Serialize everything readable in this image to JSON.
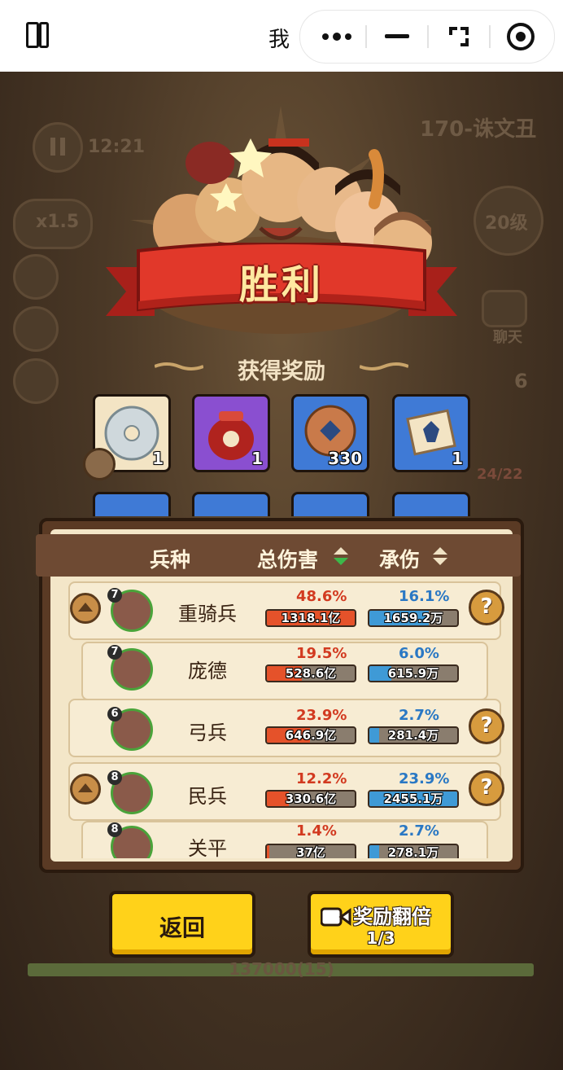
{
  "topbar": {
    "title": "我",
    "colors": {
      "bg": "#ffffff",
      "text": "#111111"
    }
  },
  "background": {
    "stage": "170-诛文丑",
    "timer": "12:21",
    "speed": "x1.5",
    "level": "20级",
    "chat": "聊天",
    "count_right": "6",
    "troops_right": "24/22",
    "score": "137000(15)"
  },
  "victory": {
    "title": "胜利",
    "reward_heading": "获得奖励"
  },
  "rewards": [
    {
      "icon": "jade-disc-icon",
      "count": "1",
      "frame": "#f3e4c4"
    },
    {
      "icon": "wine-jar-icon",
      "count": "1",
      "frame": "#8a4fd0"
    },
    {
      "icon": "bronze-coin-icon",
      "count": "330",
      "frame": "#3f7ad6"
    },
    {
      "icon": "scroll-icon",
      "count": "1",
      "frame": "#3f7ad6"
    }
  ],
  "stats": {
    "headers": {
      "unit": "兵种",
      "damage": "总伤害",
      "taken": "承伤"
    },
    "rows": [
      {
        "level": "7",
        "name": "重骑兵",
        "dmg_pct": "48.6%",
        "dmg_val": "1318.1亿",
        "dmg_fill": 1.0,
        "taken_pct": "16.1%",
        "taken_val": "1659.2万",
        "taken_fill": 0.68
      },
      {
        "level": "7",
        "name": "庞德",
        "dmg_pct": "19.5%",
        "dmg_val": "528.6亿",
        "dmg_fill": 0.4,
        "taken_pct": "6.0%",
        "taken_val": "615.9万",
        "taken_fill": 0.25
      },
      {
        "level": "6",
        "name": "弓兵",
        "dmg_pct": "23.9%",
        "dmg_val": "646.9亿",
        "dmg_fill": 0.49,
        "taken_pct": "2.7%",
        "taken_val": "281.4万",
        "taken_fill": 0.11
      },
      {
        "level": "8",
        "name": "民兵",
        "dmg_pct": "12.2%",
        "dmg_val": "330.6亿",
        "dmg_fill": 0.25,
        "taken_pct": "23.9%",
        "taken_val": "2455.1万",
        "taken_fill": 1.0
      },
      {
        "level": "8",
        "name": "关平",
        "dmg_pct": "1.4%",
        "dmg_val": "37亿",
        "dmg_fill": 0.03,
        "taken_pct": "2.7%",
        "taken_val": "278.1万",
        "taken_fill": 0.11
      }
    ],
    "colors": {
      "damage": "#e5522a",
      "taken": "#3f9ad6"
    }
  },
  "buttons": {
    "back": "返回",
    "double": "奖励翻倍",
    "double_count": "1/3"
  }
}
